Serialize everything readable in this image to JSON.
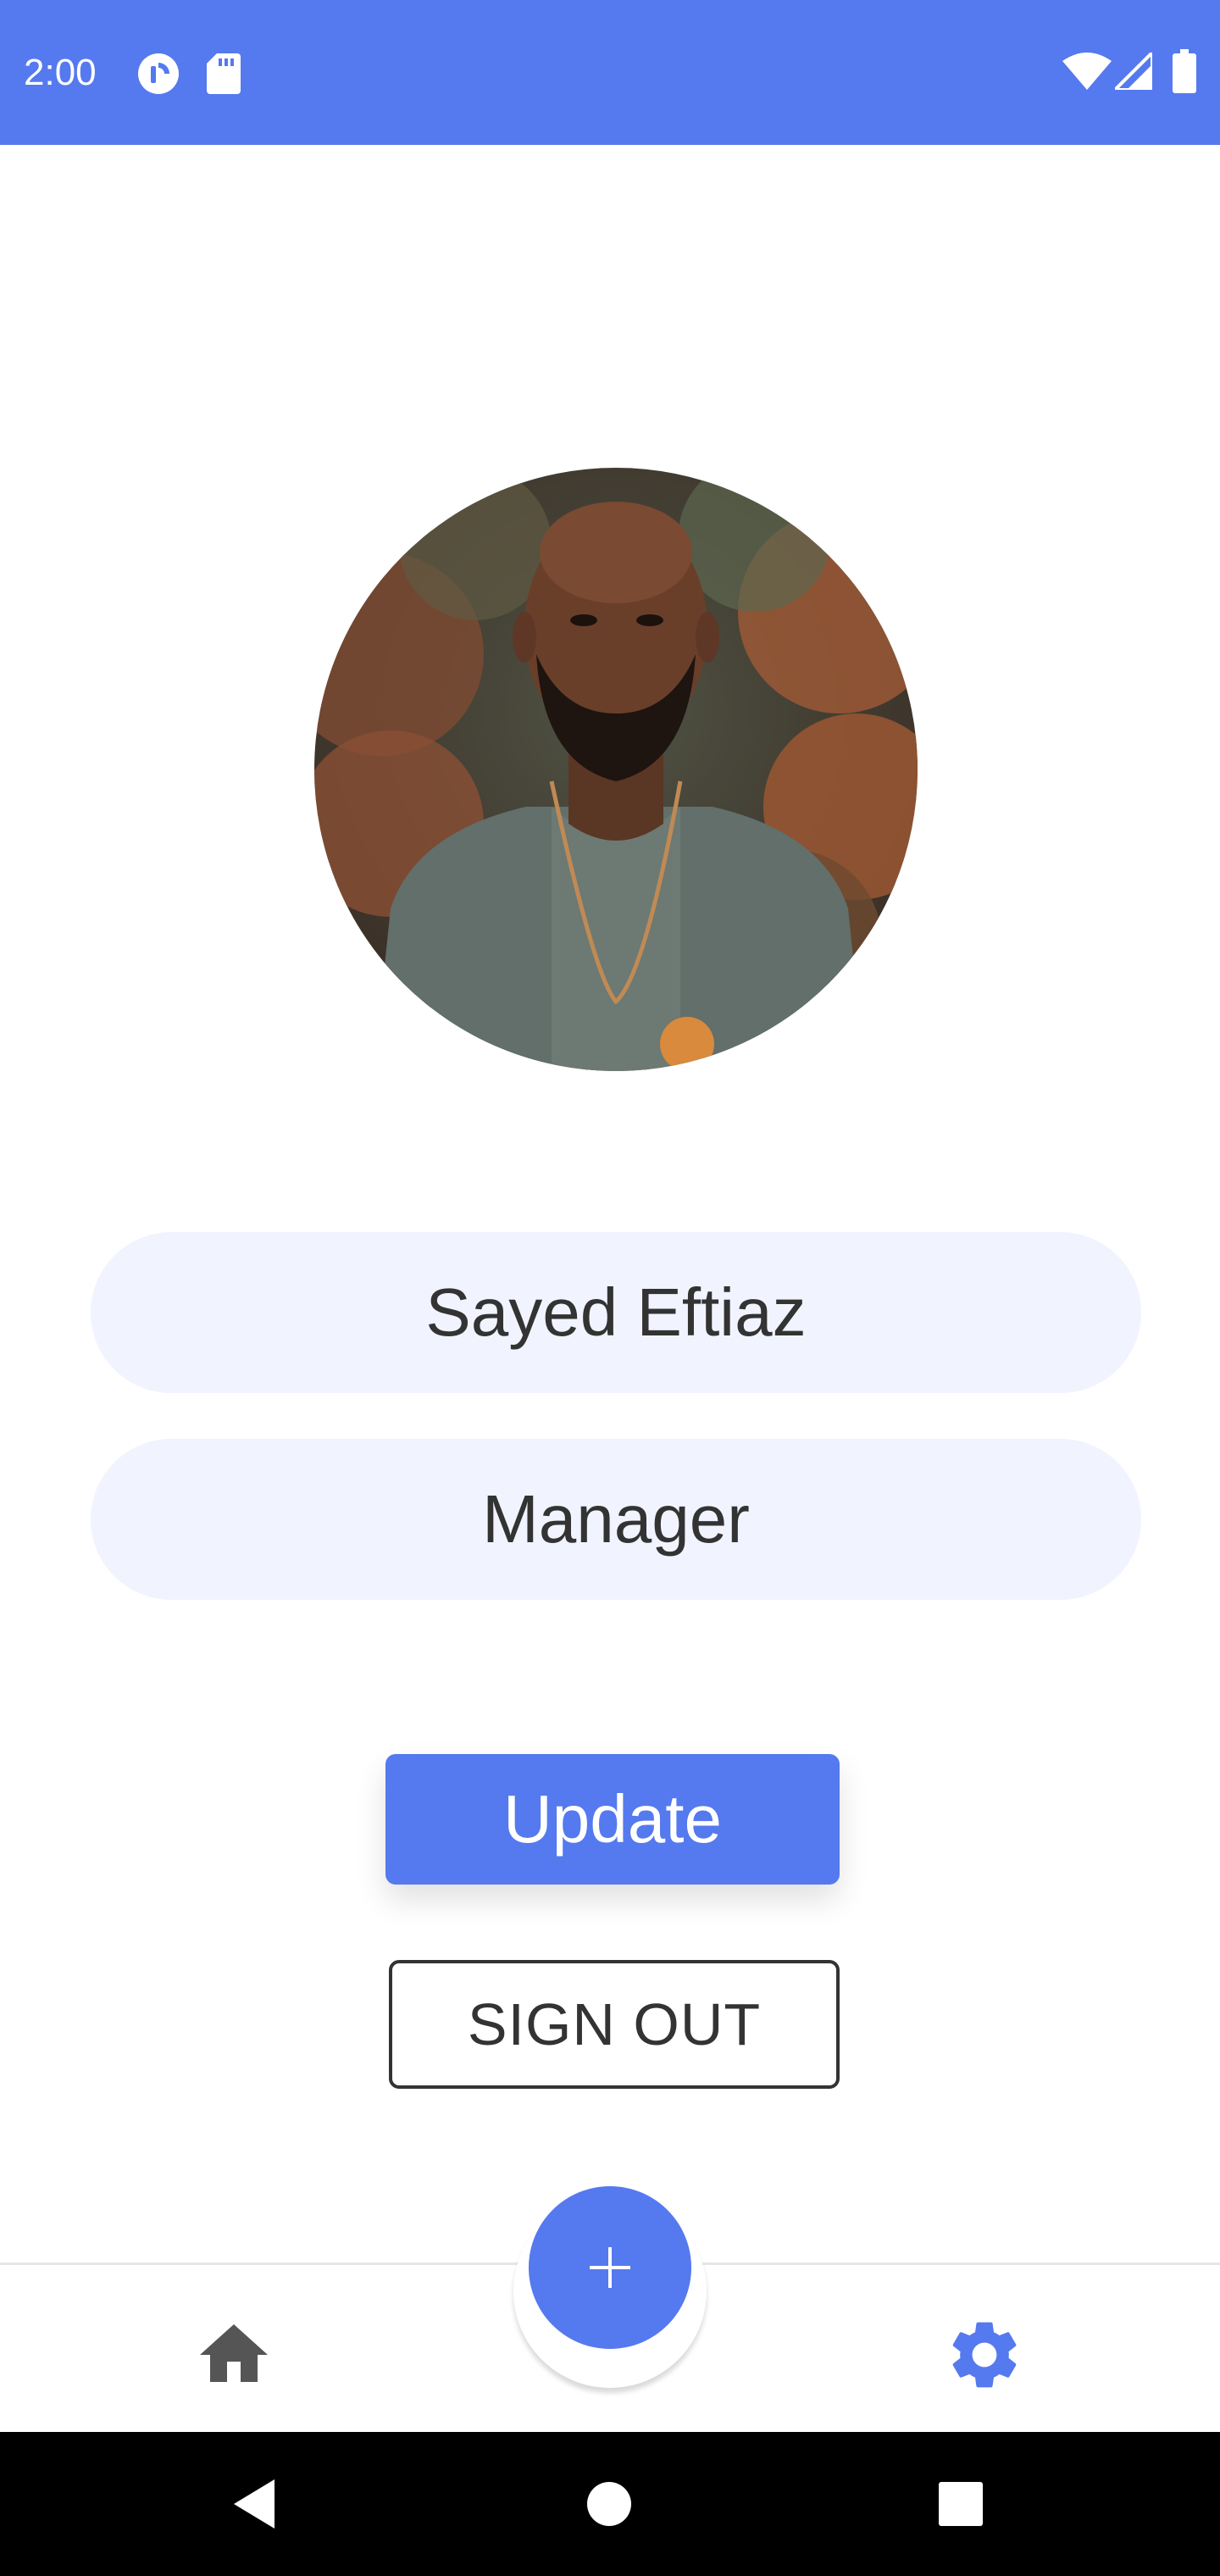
{
  "status_bar": {
    "time": "2:00",
    "left_icons": [
      "pocket-casts-icon",
      "sd-card-icon"
    ],
    "right_icons": [
      "wifi-icon",
      "cellular-signal-icon",
      "battery-icon"
    ],
    "background": "#5579EE"
  },
  "profile": {
    "avatar": "profile-photo",
    "name": "Sayed Eftiaz",
    "role": "Manager"
  },
  "actions": {
    "update_label": "Update",
    "signout_label": "SIGN OUT"
  },
  "bottom_nav": {
    "items": [
      {
        "icon": "home-icon",
        "active": false
      },
      {
        "icon": "settings-gear-icon",
        "active": true
      }
    ],
    "fab_icon": "plus-icon"
  },
  "system_nav": {
    "buttons": [
      "back-icon",
      "home-circle-icon",
      "recents-icon"
    ]
  },
  "colors": {
    "accent": "#5579EE",
    "field_background": "#F1F4FE",
    "text": "#333333",
    "nav_inactive": "#555555"
  }
}
